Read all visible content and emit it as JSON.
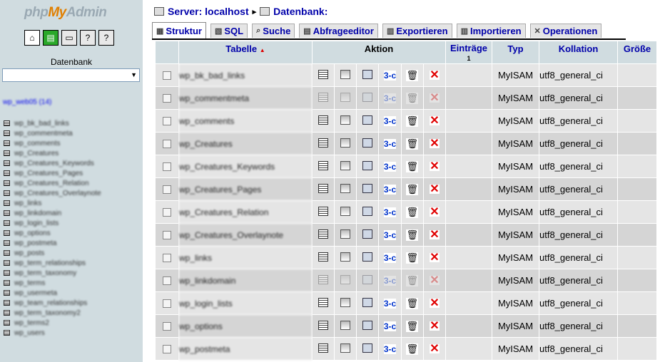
{
  "nav": {
    "logo": {
      "php": "php",
      "my": "My",
      "admin": "Admin"
    },
    "quick_icons": [
      "home-icon",
      "query-window-icon",
      "sql-icon",
      "help-icon",
      "docs-icon"
    ],
    "db_label": "Datenbank",
    "db_select_value": "",
    "db_name": "wp_web05 (14)",
    "tables": [
      "wp_bk_bad_links",
      "wp_commentmeta",
      "wp_comments",
      "wp_Creatures",
      "wp_Creatures_Keywords",
      "wp_Creatures_Pages",
      "wp_Creatures_Relation",
      "wp_Creatures_Overlaynote",
      "wp_links",
      "wp_linkdomain",
      "wp_login_lists",
      "wp_options",
      "wp_postmeta",
      "wp_posts",
      "wp_term_relationships",
      "wp_term_taxonomy",
      "wp_terms",
      "wp_usermeta",
      "wp_team_relationships",
      "wp_term_taxonomy2",
      "wp_terms2",
      "wp_users"
    ]
  },
  "breadcrumb": {
    "server": "Server: localhost",
    "sep": "▸",
    "db": "Datenbank:"
  },
  "tabs": [
    {
      "label": "Struktur",
      "icon": "structure-icon",
      "active": true
    },
    {
      "label": "SQL",
      "icon": "sql-icon",
      "active": false
    },
    {
      "label": "Suche",
      "icon": "search-icon",
      "active": false
    },
    {
      "label": "Abfrageeditor",
      "icon": "query-icon",
      "active": false
    },
    {
      "label": "Exportieren",
      "icon": "export-icon",
      "active": false
    },
    {
      "label": "Importieren",
      "icon": "import-icon",
      "active": false
    },
    {
      "label": "Operationen",
      "icon": "operations-icon",
      "active": false
    }
  ],
  "table": {
    "headers": {
      "tabelle": "Tabelle",
      "sort_arrow": "▲",
      "aktion": "Aktion",
      "eintraege": "Einträge",
      "eintraege_sub": "1",
      "typ": "Typ",
      "kollation": "Kollation",
      "groesse": "Größe"
    },
    "rows": [
      {
        "name": "wp_bk_bad_links",
        "typ": "MyISAM",
        "kollation": "utf8_general_ci",
        "empty": false
      },
      {
        "name": "wp_commentmeta",
        "typ": "MyISAM",
        "kollation": "utf8_general_ci",
        "empty": true
      },
      {
        "name": "wp_comments",
        "typ": "MyISAM",
        "kollation": "utf8_general_ci",
        "empty": false
      },
      {
        "name": "wp_Creatures",
        "typ": "MyISAM",
        "kollation": "utf8_general_ci",
        "empty": false
      },
      {
        "name": "wp_Creatures_Keywords",
        "typ": "MyISAM",
        "kollation": "utf8_general_ci",
        "empty": false
      },
      {
        "name": "wp_Creatures_Pages",
        "typ": "MyISAM",
        "kollation": "utf8_general_ci",
        "empty": false
      },
      {
        "name": "wp_Creatures_Relation",
        "typ": "MyISAM",
        "kollation": "utf8_general_ci",
        "empty": false
      },
      {
        "name": "wp_Creatures_Overlaynote",
        "typ": "MyISAM",
        "kollation": "utf8_general_ci",
        "empty": false
      },
      {
        "name": "wp_links",
        "typ": "MyISAM",
        "kollation": "utf8_general_ci",
        "empty": false
      },
      {
        "name": "wp_linkdomain",
        "typ": "MyISAM",
        "kollation": "utf8_general_ci",
        "empty": true
      },
      {
        "name": "wp_login_lists",
        "typ": "MyISAM",
        "kollation": "utf8_general_ci",
        "empty": false
      },
      {
        "name": "wp_options",
        "typ": "MyISAM",
        "kollation": "utf8_general_ci",
        "empty": false
      },
      {
        "name": "wp_postmeta",
        "typ": "MyISAM",
        "kollation": "utf8_general_ci",
        "empty": false
      }
    ]
  }
}
